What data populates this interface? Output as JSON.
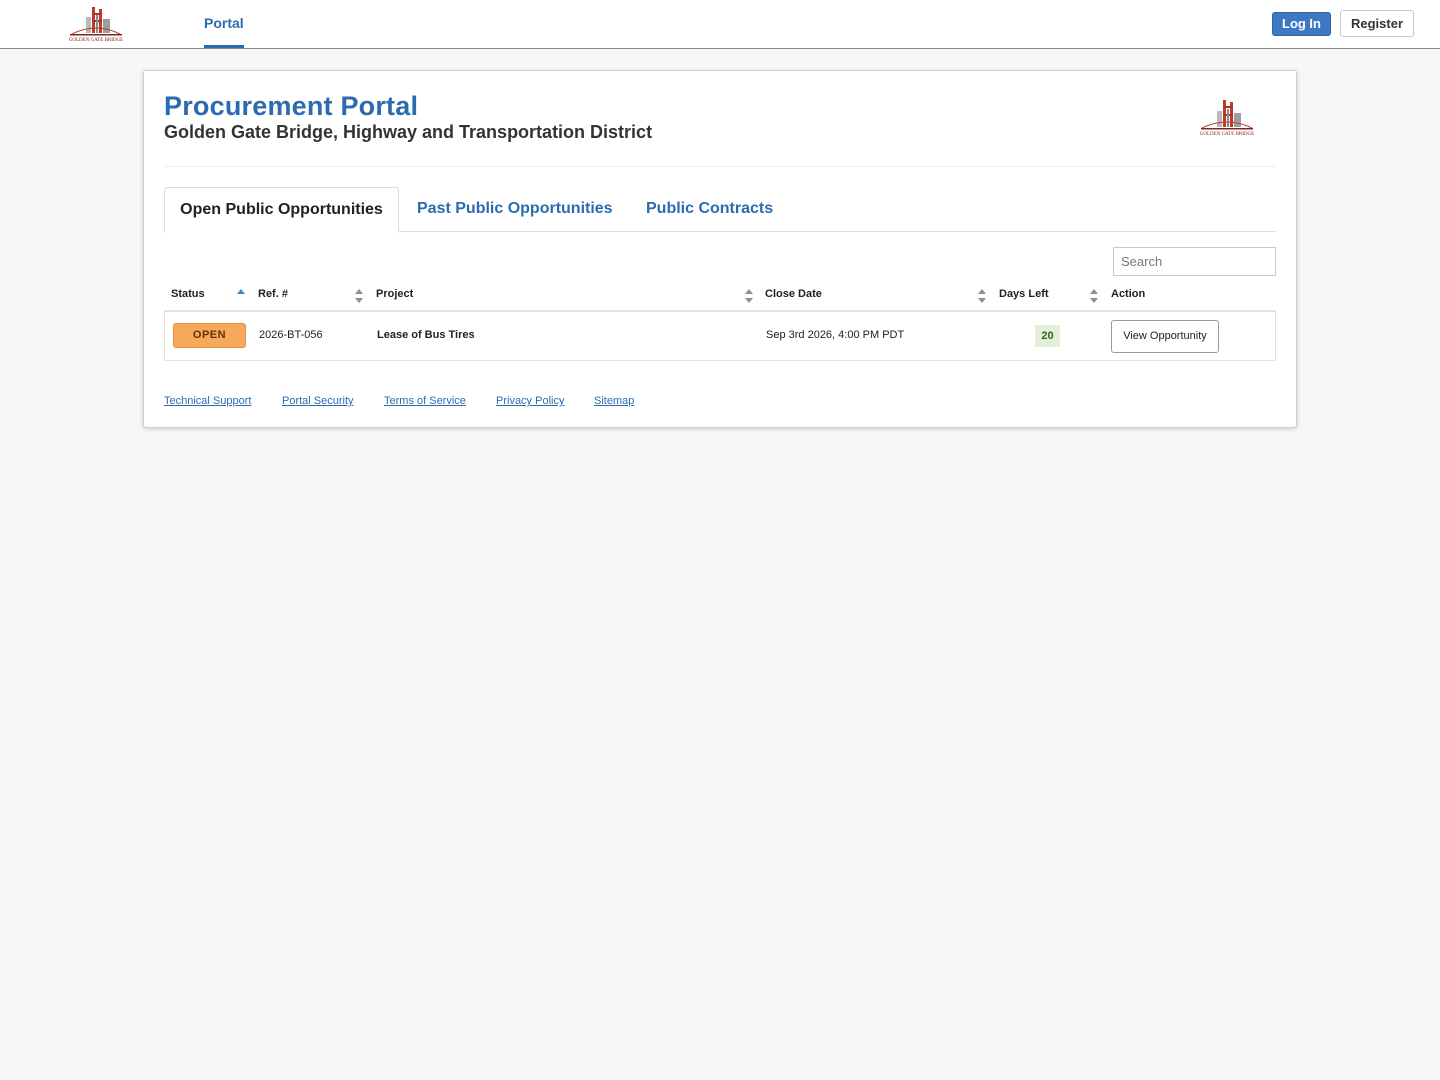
{
  "header": {
    "brand_logo_text": "GOLDEN GATE BRIDGE",
    "nav_portal": "Portal",
    "login_label": "Log In",
    "register_label": "Register"
  },
  "page": {
    "title": "Procurement Portal",
    "subtitle": "Golden Gate Bridge, Highway and Transportation District"
  },
  "tabs": [
    {
      "label": "Open Public Opportunities",
      "active": true
    },
    {
      "label": "Past Public Opportunities",
      "active": false
    },
    {
      "label": "Public Contracts",
      "active": false
    }
  ],
  "search": {
    "placeholder": "Search",
    "value": ""
  },
  "table": {
    "columns": [
      "Status",
      "Ref. #",
      "Project",
      "Close Date",
      "Days Left",
      "Action"
    ],
    "rows": [
      {
        "status": "OPEN",
        "ref": "2026-BT-056",
        "project": "Lease of Bus Tires",
        "close_date": "Sep 3rd 2026, 4:00 PM PDT",
        "days_left": "20",
        "action": "View Opportunity"
      }
    ]
  },
  "footer": {
    "links": [
      "Technical Support",
      "Portal Security",
      "Terms of Service",
      "Privacy Policy",
      "Sitemap"
    ]
  },
  "colors": {
    "accent": "#2b6cb0",
    "login_button": "#3d78c4",
    "status_open": "#f6a95b",
    "days_left_bg": "#e2efd9"
  },
  "icons": {
    "brand": "golden-gate-bridge-logo",
    "sort_asc": "sort-ascending-icon",
    "sort_both": "sort-icon"
  }
}
